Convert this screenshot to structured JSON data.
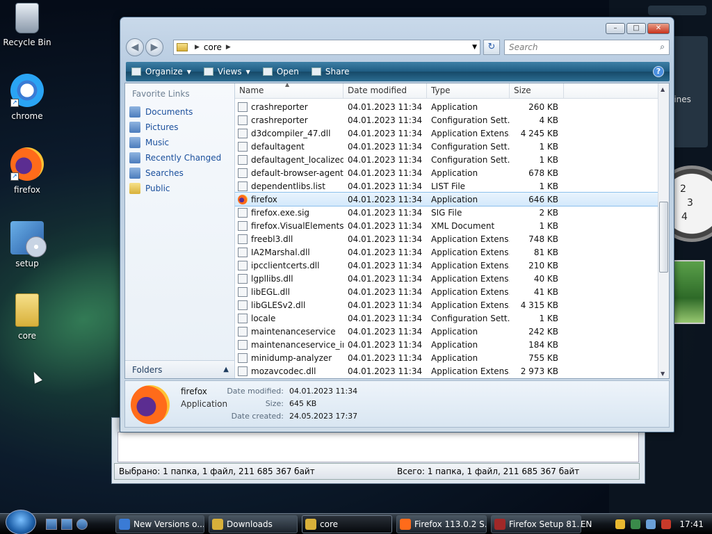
{
  "desktop": {
    "icons": [
      {
        "label": "Recycle Bin"
      },
      {
        "label": "chrome"
      },
      {
        "label": "firefox"
      },
      {
        "label": "setup"
      },
      {
        "label": "core"
      }
    ],
    "gadget_text": "lines",
    "clock_numbers": [
      "2",
      "3",
      "4"
    ]
  },
  "window": {
    "address": {
      "folder": "core"
    },
    "search_placeholder": "Search",
    "toolbar": {
      "organize": "Organize",
      "views": "Views",
      "open": "Open",
      "share": "Share",
      "help": "?"
    },
    "nav_pane": {
      "title": "Favorite Links",
      "items": [
        {
          "label": "Documents",
          "icon": "documents-icon"
        },
        {
          "label": "Pictures",
          "icon": "pictures-icon"
        },
        {
          "label": "Music",
          "icon": "music-icon"
        },
        {
          "label": "Recently Changed",
          "icon": "recent-icon"
        },
        {
          "label": "Searches",
          "icon": "searches-icon"
        },
        {
          "label": "Public",
          "icon": "folder-icon"
        }
      ],
      "folders_label": "Folders"
    },
    "columns": {
      "name": "Name",
      "date": "Date modified",
      "type": "Type",
      "size": "Size"
    },
    "files": [
      {
        "name": "crashreporter",
        "date": "04.01.2023 11:34",
        "type": "Application",
        "size": "260 KB"
      },
      {
        "name": "crashreporter",
        "date": "04.01.2023 11:34",
        "type": "Configuration Sett...",
        "size": "4 KB"
      },
      {
        "name": "d3dcompiler_47.dll",
        "date": "04.01.2023 11:34",
        "type": "Application Extens...",
        "size": "4 245 KB"
      },
      {
        "name": "defaultagent",
        "date": "04.01.2023 11:34",
        "type": "Configuration Sett...",
        "size": "1 KB"
      },
      {
        "name": "defaultagent_localized",
        "date": "04.01.2023 11:34",
        "type": "Configuration Sett...",
        "size": "1 KB"
      },
      {
        "name": "default-browser-agent",
        "date": "04.01.2023 11:34",
        "type": "Application",
        "size": "678 KB"
      },
      {
        "name": "dependentlibs.list",
        "date": "04.01.2023 11:34",
        "type": "LIST File",
        "size": "1 KB"
      },
      {
        "name": "firefox",
        "date": "04.01.2023 11:34",
        "type": "Application",
        "size": "646 KB",
        "selected": true
      },
      {
        "name": "firefox.exe.sig",
        "date": "04.01.2023 11:34",
        "type": "SIG File",
        "size": "2 KB"
      },
      {
        "name": "firefox.VisualElements...",
        "date": "04.01.2023 11:34",
        "type": "XML Document",
        "size": "1 KB"
      },
      {
        "name": "freebl3.dll",
        "date": "04.01.2023 11:34",
        "type": "Application Extens...",
        "size": "748 KB"
      },
      {
        "name": "IA2Marshal.dll",
        "date": "04.01.2023 11:34",
        "type": "Application Extens...",
        "size": "81 KB"
      },
      {
        "name": "ipcclientcerts.dll",
        "date": "04.01.2023 11:34",
        "type": "Application Extens...",
        "size": "210 KB"
      },
      {
        "name": "lgpllibs.dll",
        "date": "04.01.2023 11:34",
        "type": "Application Extens...",
        "size": "40 KB"
      },
      {
        "name": "libEGL.dll",
        "date": "04.01.2023 11:34",
        "type": "Application Extens...",
        "size": "41 KB"
      },
      {
        "name": "libGLESv2.dll",
        "date": "04.01.2023 11:34",
        "type": "Application Extens...",
        "size": "4 315 KB"
      },
      {
        "name": "locale",
        "date": "04.01.2023 11:34",
        "type": "Configuration Sett...",
        "size": "1 KB"
      },
      {
        "name": "maintenanceservice",
        "date": "04.01.2023 11:34",
        "type": "Application",
        "size": "242 KB"
      },
      {
        "name": "maintenanceservice_in...",
        "date": "04.01.2023 11:34",
        "type": "Application",
        "size": "184 KB"
      },
      {
        "name": "minidump-analyzer",
        "date": "04.01.2023 11:34",
        "type": "Application",
        "size": "755 KB"
      },
      {
        "name": "mozavcodec.dll",
        "date": "04.01.2023 11:34",
        "type": "Application Extens...",
        "size": "2 973 KB"
      }
    ],
    "details": {
      "name": "firefox",
      "type": "Application",
      "modified_label": "Date modified:",
      "modified": "04.01.2023 11:34",
      "size_label": "Size:",
      "size": "645 KB",
      "created_label": "Date created:",
      "created": "24.05.2023 17:37"
    }
  },
  "back_window": {
    "status_left": "Выбрано: 1 папка, 1 файл, 211 685 367 байт",
    "status_right": "Всего: 1 папка, 1 файл, 211 685 367 байт"
  },
  "taskbar": {
    "tasks": [
      {
        "label": "New Versions o...",
        "color": "#3a7bd5"
      },
      {
        "label": "Downloads",
        "color": "#d8b03a"
      },
      {
        "label": "core",
        "color": "#d8b03a",
        "active": true
      },
      {
        "label": "Firefox 113.0.2 S...",
        "color": "#ff6b1a"
      },
      {
        "label": "Firefox Setup 81...",
        "color": "#a02828"
      }
    ],
    "lang": "EN",
    "time": "17:41"
  }
}
